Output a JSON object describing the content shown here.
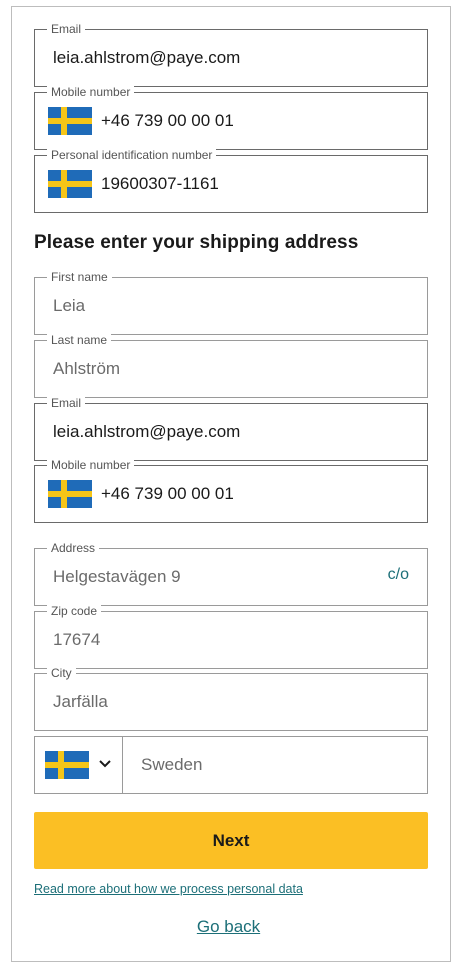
{
  "contact": {
    "email": {
      "label": "Email",
      "value": "leia.ahlstrom@paye.com"
    },
    "mobile": {
      "label": "Mobile number",
      "value": "+46 739 00 00 01",
      "flag": "sweden-flag-icon"
    },
    "pin": {
      "label": "Personal identification number",
      "value": "19600307-1161",
      "flag": "sweden-flag-icon"
    }
  },
  "shipping": {
    "heading": "Please enter your shipping address",
    "first_name": {
      "label": "First name",
      "value": "Leia"
    },
    "last_name": {
      "label": "Last name",
      "value": "Ahlström"
    },
    "email": {
      "label": "Email",
      "value": "leia.ahlstrom@paye.com"
    },
    "mobile": {
      "label": "Mobile number",
      "value": "+46 739 00 00 01",
      "flag": "sweden-flag-icon"
    },
    "address": {
      "label": "Address",
      "value": "Helgestavägen 9",
      "co_link": "c/o"
    },
    "zip": {
      "label": "Zip code",
      "value": "17674"
    },
    "city": {
      "label": "City",
      "value": "Jarfälla"
    },
    "country": {
      "value": "Sweden",
      "flag": "sweden-flag-icon",
      "dropdown_icon": "chevron-down-icon"
    }
  },
  "actions": {
    "next_label": "Next",
    "privacy_link": "Read more about how we process personal data",
    "go_back": "Go back"
  },
  "colors": {
    "accent_button": "#fbbf24",
    "link": "#1c6f78",
    "flag_blue": "#1f6bb8",
    "flag_yellow": "#f5c518"
  }
}
